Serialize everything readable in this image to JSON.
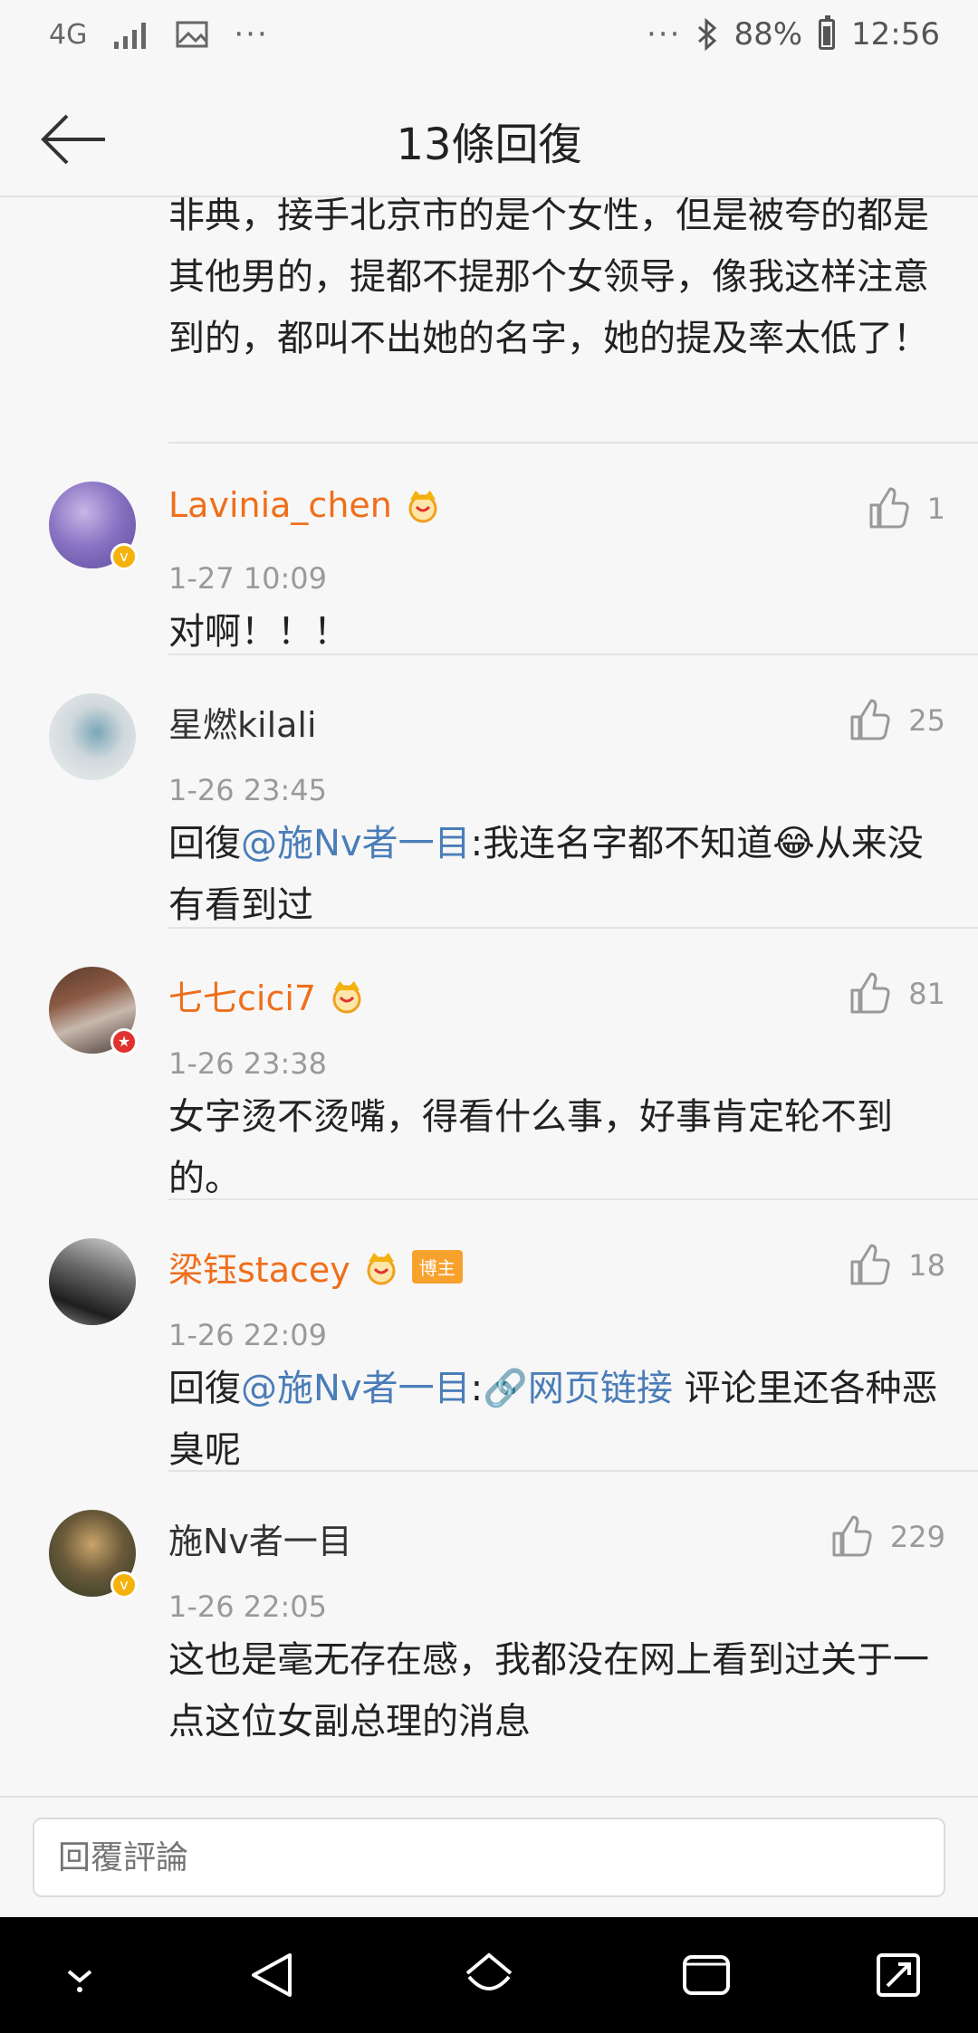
{
  "status_bar": {
    "network": "4G",
    "battery": "88%",
    "time": "12:56"
  },
  "header": {
    "title": "13條回復"
  },
  "partial_comment": {
    "text": "非典，接手北京市的是个女性，但是被夸的都是其他男的，提都不提那个女领导，像我这样注意到的，都叫不出她的名字，她的提及率太低了！"
  },
  "comments": [
    {
      "username": "Lavinia_chen",
      "time": "1-27 10:09",
      "likes": "1",
      "text": "对啊！！！"
    },
    {
      "username": "星燃kilali",
      "time": "1-26 23:45",
      "likes": "25",
      "reply_prefix": "回復",
      "mention": "@施Nv者一目",
      "text_after": ":我连名字都不知道😂从来没有看到过"
    },
    {
      "username": "七七cici7",
      "time": "1-26 23:38",
      "likes": "81",
      "text": "女字烫不烫嘴，得看什么事，好事肯定轮不到的。"
    },
    {
      "username": "梁钰stacey",
      "tag": "博主",
      "time": "1-26 22:09",
      "likes": "18",
      "reply_prefix": "回復",
      "mention": "@施Nv者一目",
      "colon": ":",
      "link_text": "🔗网页链接",
      "text_after": " 评论里还各种恶臭呢"
    },
    {
      "username": "施Nv者一目",
      "time": "1-26 22:05",
      "likes": "229",
      "text": "这也是毫无存在感，我都没在网上看到过关于一点这位女副总理的消息"
    }
  ],
  "reply_bar": {
    "placeholder": "回覆評論"
  },
  "colors": {
    "vip_name": "#f06e1a",
    "mention": "#4a7db8",
    "verified_badge": "#f5b20c",
    "tag": "#f8a22e"
  }
}
